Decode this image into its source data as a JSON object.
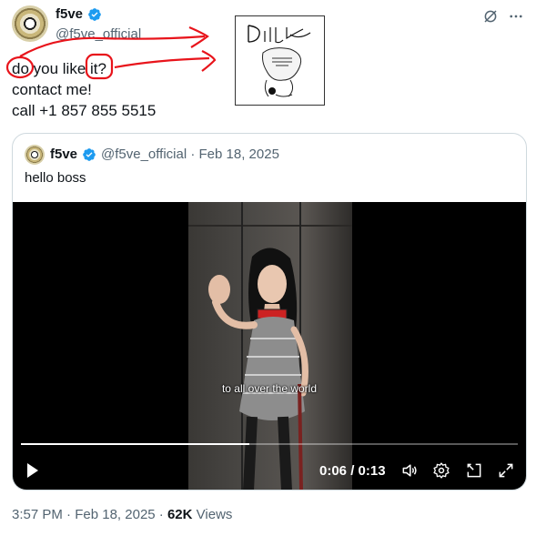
{
  "author": {
    "display_name": "f5ve",
    "handle": "@f5ve_official"
  },
  "tweet": {
    "lines": [
      "do you like it?",
      "contact me!",
      "call +1 857 855 5515"
    ]
  },
  "quoted": {
    "display_name": "f5ve",
    "handle": "@f5ve_official",
    "separator": "·",
    "date": "Feb 18, 2025",
    "text": "hello boss",
    "video": {
      "caption": "to all over the world",
      "current_time": "0:06",
      "duration": "0:13",
      "time_display": "0:06 / 0:13",
      "progress": 0.46
    }
  },
  "footer": {
    "time": "3:57 PM",
    "dot1": "·",
    "date": "Feb 18, 2025",
    "dot2": "·",
    "views_count": "62K",
    "views_label": "Views"
  },
  "colors": {
    "verified": "#1d9bf0",
    "annotation": "#e8141b",
    "text": "#0f1419",
    "muted": "#536471",
    "border": "#cfd9de"
  },
  "icons": [
    "grok-icon",
    "more-icon",
    "verified-badge-icon",
    "play-icon",
    "volume-icon",
    "settings-icon",
    "pip-icon",
    "fullscreen-icon"
  ]
}
